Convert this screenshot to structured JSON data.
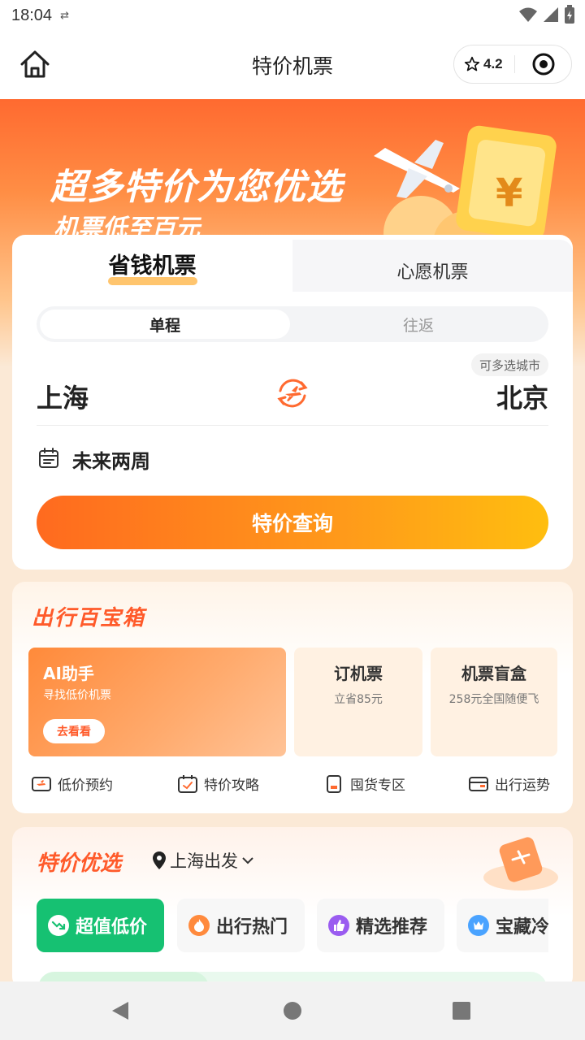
{
  "status_bar": {
    "time": "18:04",
    "sync_glyph": "⇄"
  },
  "nav": {
    "title": "特价机票",
    "rating": "4.2"
  },
  "hero": {
    "title": "超多特价为您优选",
    "subtitle": "机票低至百元",
    "coin_label": "¥"
  },
  "search": {
    "tabs": {
      "save": "省钱机票",
      "wish": "心愿机票"
    },
    "trip_types": {
      "oneway": "单程",
      "round": "往返"
    },
    "multi_city": "可多选城市",
    "from_city": "上海",
    "to_city": "北京",
    "date": "未来两周",
    "button": "特价查询"
  },
  "toolbox": {
    "title": "出行百宝箱",
    "ai": {
      "title": "AI助手",
      "subtitle": "寻找低价机票",
      "button": "去看看"
    },
    "cards": [
      {
        "title": "订机票",
        "subtitle": "立省85元"
      },
      {
        "title": "机票盲盒",
        "subtitle": "258元全国随便飞"
      }
    ],
    "shortcuts": [
      {
        "label": "低价预约",
        "icon": "ticket-plane-icon"
      },
      {
        "label": "特价攻略",
        "icon": "calendar-check-icon"
      },
      {
        "label": "囤货专区",
        "icon": "book-icon"
      },
      {
        "label": "出行运势",
        "icon": "wallet-icon"
      }
    ]
  },
  "deals": {
    "title": "特价优选",
    "location": "上海出发",
    "chips": [
      {
        "label": "超值低价",
        "icon": "trend-down-icon",
        "active": true
      },
      {
        "label": "出行热门",
        "icon": "flame-icon",
        "active": false
      },
      {
        "label": "精选推荐",
        "icon": "thumbs-up-icon",
        "active": false
      },
      {
        "label": "宝藏冷门",
        "icon": "crown-icon",
        "active": false
      }
    ]
  },
  "colors": {
    "accent": "#ff6a1f",
    "green": "#16c172",
    "orange_title": "#ff5a2a"
  }
}
